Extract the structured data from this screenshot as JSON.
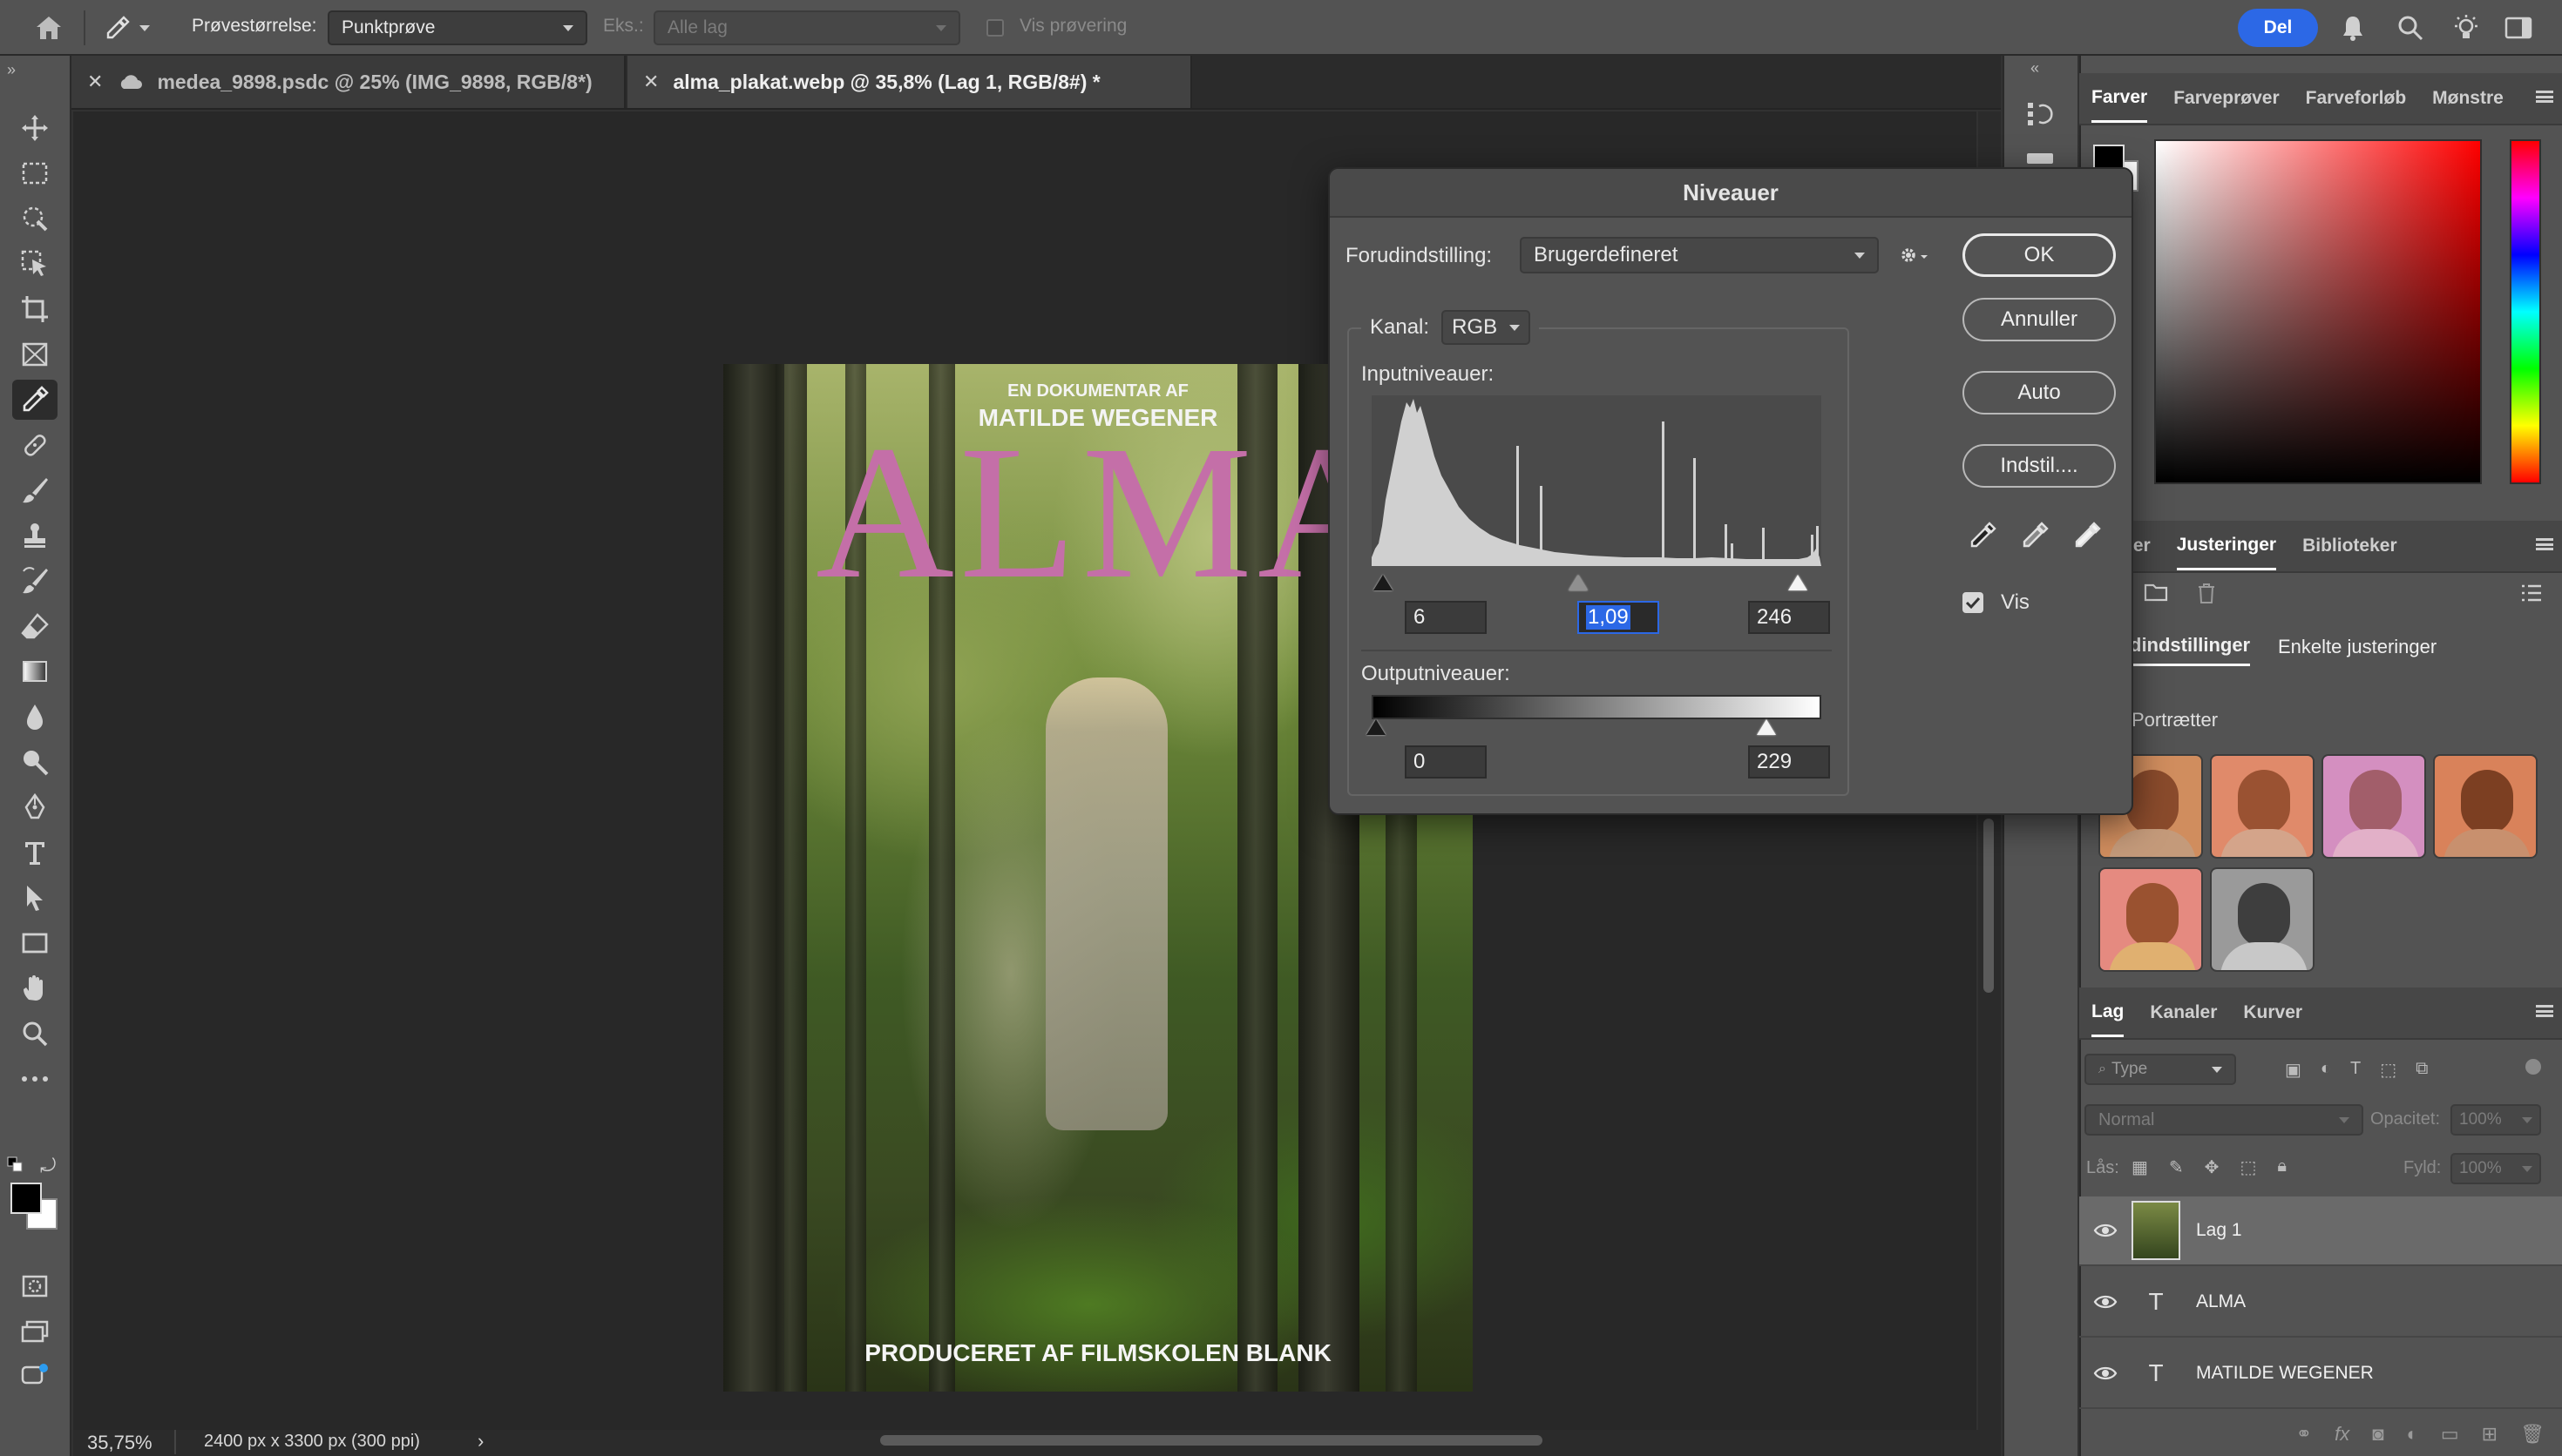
{
  "options_bar": {
    "sample_size_label": "Prøvestørrelse:",
    "sample_size_value": "Punktprøve",
    "sample_label": "Eks.:",
    "sample_value": "Alle lag",
    "show_ring_label": "Vis prøvering",
    "share_label": "Del"
  },
  "tabs": [
    {
      "label": "medea_9898.psdc @ 25% (IMG_9898, RGB/8*)"
    },
    {
      "label": "alma_plakat.webp @ 35,8% (Lag 1, RGB/8#) *"
    }
  ],
  "poster": {
    "kicker": "EN DOKUMENTAR AF",
    "director": "MATILDE WEGENER",
    "title": "ALMA",
    "credit": "PRODUCERET AF FILMSKOLEN BLANK"
  },
  "status": {
    "zoom": "35,75%",
    "doc_size": "2400 px x 3300 px (300 ppi)"
  },
  "levels_dialog": {
    "title": "Niveauer",
    "preset_label": "Forudindstilling:",
    "preset_value": "Brugerdefineret",
    "channel_label": "Kanal:",
    "channel_value": "RGB",
    "input_label": "Inputniveauer:",
    "input_black": "6",
    "input_gamma": "1,09",
    "input_white": "246",
    "output_label": "Outputniveauer:",
    "output_black": "0",
    "output_white": "229",
    "buttons": {
      "ok": "OK",
      "cancel": "Annuller",
      "auto": "Auto",
      "options": "Indstil...."
    },
    "preview_label": "Vis",
    "preview_checked": true
  },
  "color_panel": {
    "tabs": [
      "Farver",
      "Farveprøver",
      "Farveforløb",
      "Mønstre"
    ],
    "active_tab": "Farver"
  },
  "adjust_panel": {
    "tabs": [
      "skaber",
      "Justeringer",
      "Biblioteker"
    ],
    "active_tab": "Justeringer",
    "subtabs": [
      "dindstillinger",
      "Enkelte justeringer"
    ],
    "group_label": "Portrætter"
  },
  "layers_panel": {
    "tabs": [
      "Lag",
      "Kanaler",
      "Kurver"
    ],
    "filter_placeholder": "Type",
    "blend_mode": "Normal",
    "opacity_label": "Opacitet:",
    "opacity_value": "100%",
    "lock_label": "Lås:",
    "fill_label": "Fyld:",
    "fill_value": "100%",
    "layers": [
      {
        "name": "Lag 1",
        "kind": "pixel"
      },
      {
        "name": "ALMA",
        "kind": "text"
      },
      {
        "name": "MATILDE WEGENER",
        "kind": "text"
      }
    ]
  },
  "colors": {
    "accent": "#2c68e6",
    "title_pink": "#c46fa8"
  }
}
